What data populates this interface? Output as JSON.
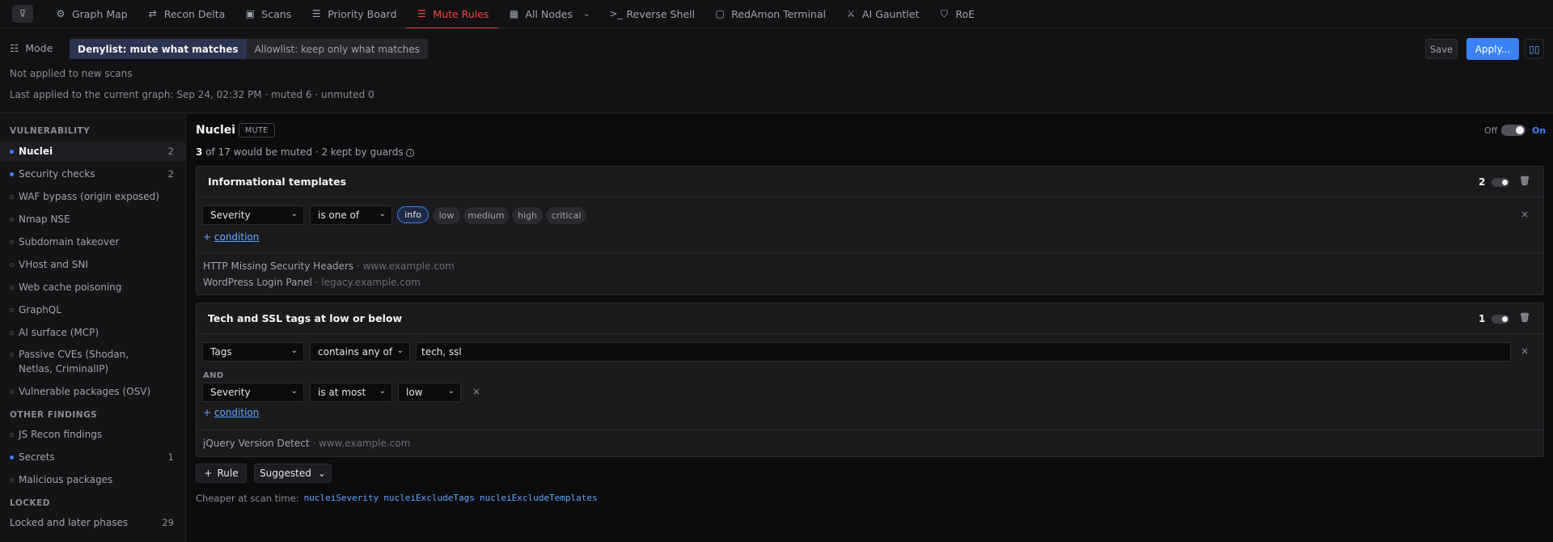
{
  "nav": {
    "tabs": [
      {
        "label": "Graph Map",
        "icon": "graph-icon"
      },
      {
        "label": "Recon Delta",
        "icon": "delta-icon"
      },
      {
        "label": "Scans",
        "icon": "scan-icon"
      },
      {
        "label": "Priority Board",
        "icon": "list-icon"
      },
      {
        "label": "Mute Rules",
        "icon": "mute-icon"
      },
      {
        "label": "All Nodes",
        "icon": "table-icon"
      },
      {
        "label": "Reverse Shell",
        "icon": "terminal-prompt-icon"
      },
      {
        "label": "RedAmon Terminal",
        "icon": "terminal-icon"
      },
      {
        "label": "AI Gauntlet",
        "icon": "swords-icon"
      },
      {
        "label": "RoE",
        "icon": "shield-icon"
      }
    ],
    "active": "Mute Rules",
    "accent": "#ef4444"
  },
  "modebar": {
    "mode_label": "Mode",
    "denylist_label": "Denylist: mute what matches",
    "allowlist_label": "Allowlist: keep only what matches",
    "not_applied": "Not applied to new scans",
    "last_applied": "Last applied to the current graph: Sep 24, 02:32 PM · muted 6 · unmuted 0",
    "save_label": "Save",
    "apply_label": "Apply..."
  },
  "sidebar": {
    "sections": {
      "vulnerability": "VULNERABILITY",
      "other": "OTHER FINDINGS",
      "locked": "LOCKED"
    },
    "items": [
      {
        "label": "Nuclei",
        "count": "2",
        "active": true,
        "dot": "blue"
      },
      {
        "label": "Security checks",
        "count": "2",
        "dot": "blue"
      },
      {
        "label": "WAF bypass (origin exposed)",
        "count": "",
        "dot": "empty"
      },
      {
        "label": "Nmap NSE",
        "count": "",
        "dot": "empty"
      },
      {
        "label": "Subdomain takeover",
        "count": "",
        "dot": "empty"
      },
      {
        "label": "VHost and SNI",
        "count": "",
        "dot": "empty"
      },
      {
        "label": "Web cache poisoning",
        "count": "",
        "dot": "empty"
      },
      {
        "label": "GraphQL",
        "count": "",
        "dot": "empty"
      },
      {
        "label": "AI surface (MCP)",
        "count": "",
        "dot": "empty"
      },
      {
        "label": "Passive CVEs (Shodan, Netlas, CriminalIP)",
        "count": "",
        "dot": "empty"
      },
      {
        "label": "Vulnerable packages (OSV)",
        "count": "",
        "dot": "empty"
      },
      {
        "label": "JS Recon findings",
        "count": "",
        "dot": "empty"
      },
      {
        "label": "Secrets",
        "count": "1",
        "dot": "blue"
      },
      {
        "label": "Malicious packages",
        "count": "",
        "dot": "empty"
      },
      {
        "label": "Locked and later phases",
        "count": "29"
      }
    ]
  },
  "main": {
    "title": "Nuclei",
    "badge": "MUTE",
    "summary_count": "3",
    "summary_rest": "of 17 would be muted · 2 kept by guards",
    "toggle_off": "Off",
    "toggle_on": "On",
    "rules": [
      {
        "name": "Informational templates",
        "count": "2",
        "field": "Severity",
        "op": "is one of",
        "chips": [
          "info",
          "low",
          "medium",
          "high",
          "critical"
        ],
        "selected_chip": "info",
        "add_condition": "condition",
        "matches": [
          {
            "name": "HTTP Missing Security Headers",
            "host": "www.example.com"
          },
          {
            "name": "WordPress Login Panel",
            "host": "legacy.example.com"
          }
        ]
      },
      {
        "name": "Tech and SSL tags at low or below",
        "count": "1",
        "field": "Tags",
        "op": "contains any of",
        "value": "tech, ssl",
        "and_label": "AND",
        "field2": "Severity",
        "op2": "is at most",
        "value2": "low",
        "add_condition": "condition",
        "matches": [
          {
            "name": "jQuery Version Detect",
            "host": "www.example.com"
          }
        ]
      }
    ],
    "add_rule_label": "Rule",
    "suggested_label": "Suggested",
    "cheaper_label": "Cheaper at scan time:",
    "cheaper_keys": [
      "nucleiSeverity",
      "nucleiExcludeTags",
      "nucleiExcludeTemplates"
    ]
  }
}
